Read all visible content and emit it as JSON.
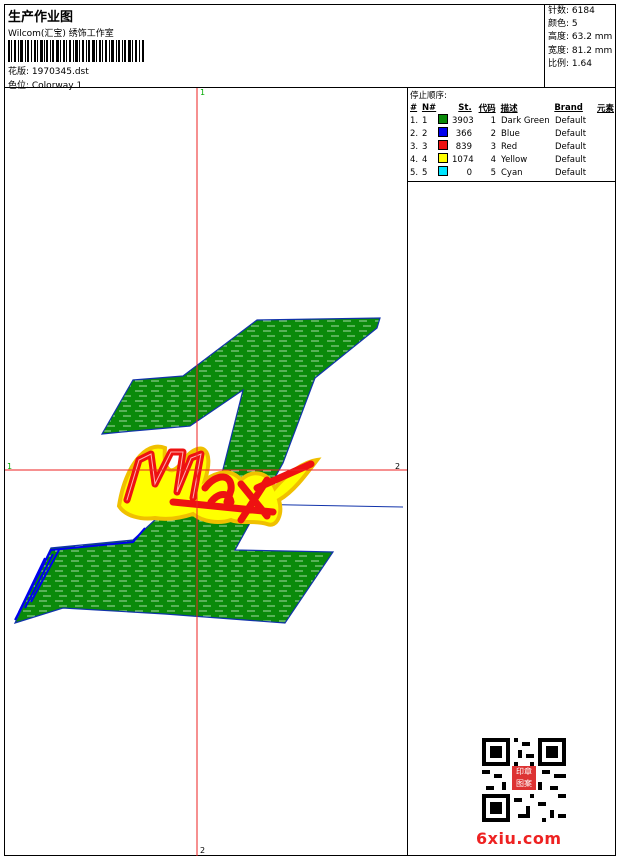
{
  "header": {
    "title": "生产作业图",
    "company": "Wilcom(汇宝) 绣饰工作室",
    "design_label": "花版: 1970345.dst",
    "colorway_label": "色位: Colorway 1"
  },
  "stats": {
    "stitches": "针数: 6184",
    "colors": "颜色: 5",
    "height": "高度: 63.2 mm",
    "width": "宽度: 81.2 mm",
    "scale": "比例: 1.64"
  },
  "stop_sequence": {
    "title": "停止顺序:",
    "headers": [
      "#",
      "N#",
      "St.",
      "代码",
      "描述",
      "Brand",
      "元素"
    ],
    "rows": [
      {
        "idx": "1.",
        "no": "1",
        "color": "#0a8a0a",
        "stitches": "3903",
        "code": "1",
        "desc": "Dark Green",
        "brand": "Default"
      },
      {
        "idx": "2.",
        "no": "2",
        "color": "#0000ee",
        "stitches": "366",
        "code": "2",
        "desc": "Blue",
        "brand": "Default"
      },
      {
        "idx": "3.",
        "no": "3",
        "color": "#ee1111",
        "stitches": "839",
        "code": "3",
        "desc": "Red",
        "brand": "Default"
      },
      {
        "idx": "4.",
        "no": "4",
        "color": "#ffff00",
        "stitches": "1074",
        "code": "4",
        "desc": "Yellow",
        "brand": "Default"
      },
      {
        "idx": "5.",
        "no": "5",
        "color": "#00e5ff",
        "stitches": "0",
        "code": "5",
        "desc": "Cyan",
        "brand": "Default"
      }
    ]
  },
  "canvas": {
    "axis_top": "1",
    "axis_left": "1",
    "axis_right": "2",
    "axis_bottom": "2"
  },
  "watermark": "6xiu.com",
  "qr_logo_text": "印章 图案"
}
